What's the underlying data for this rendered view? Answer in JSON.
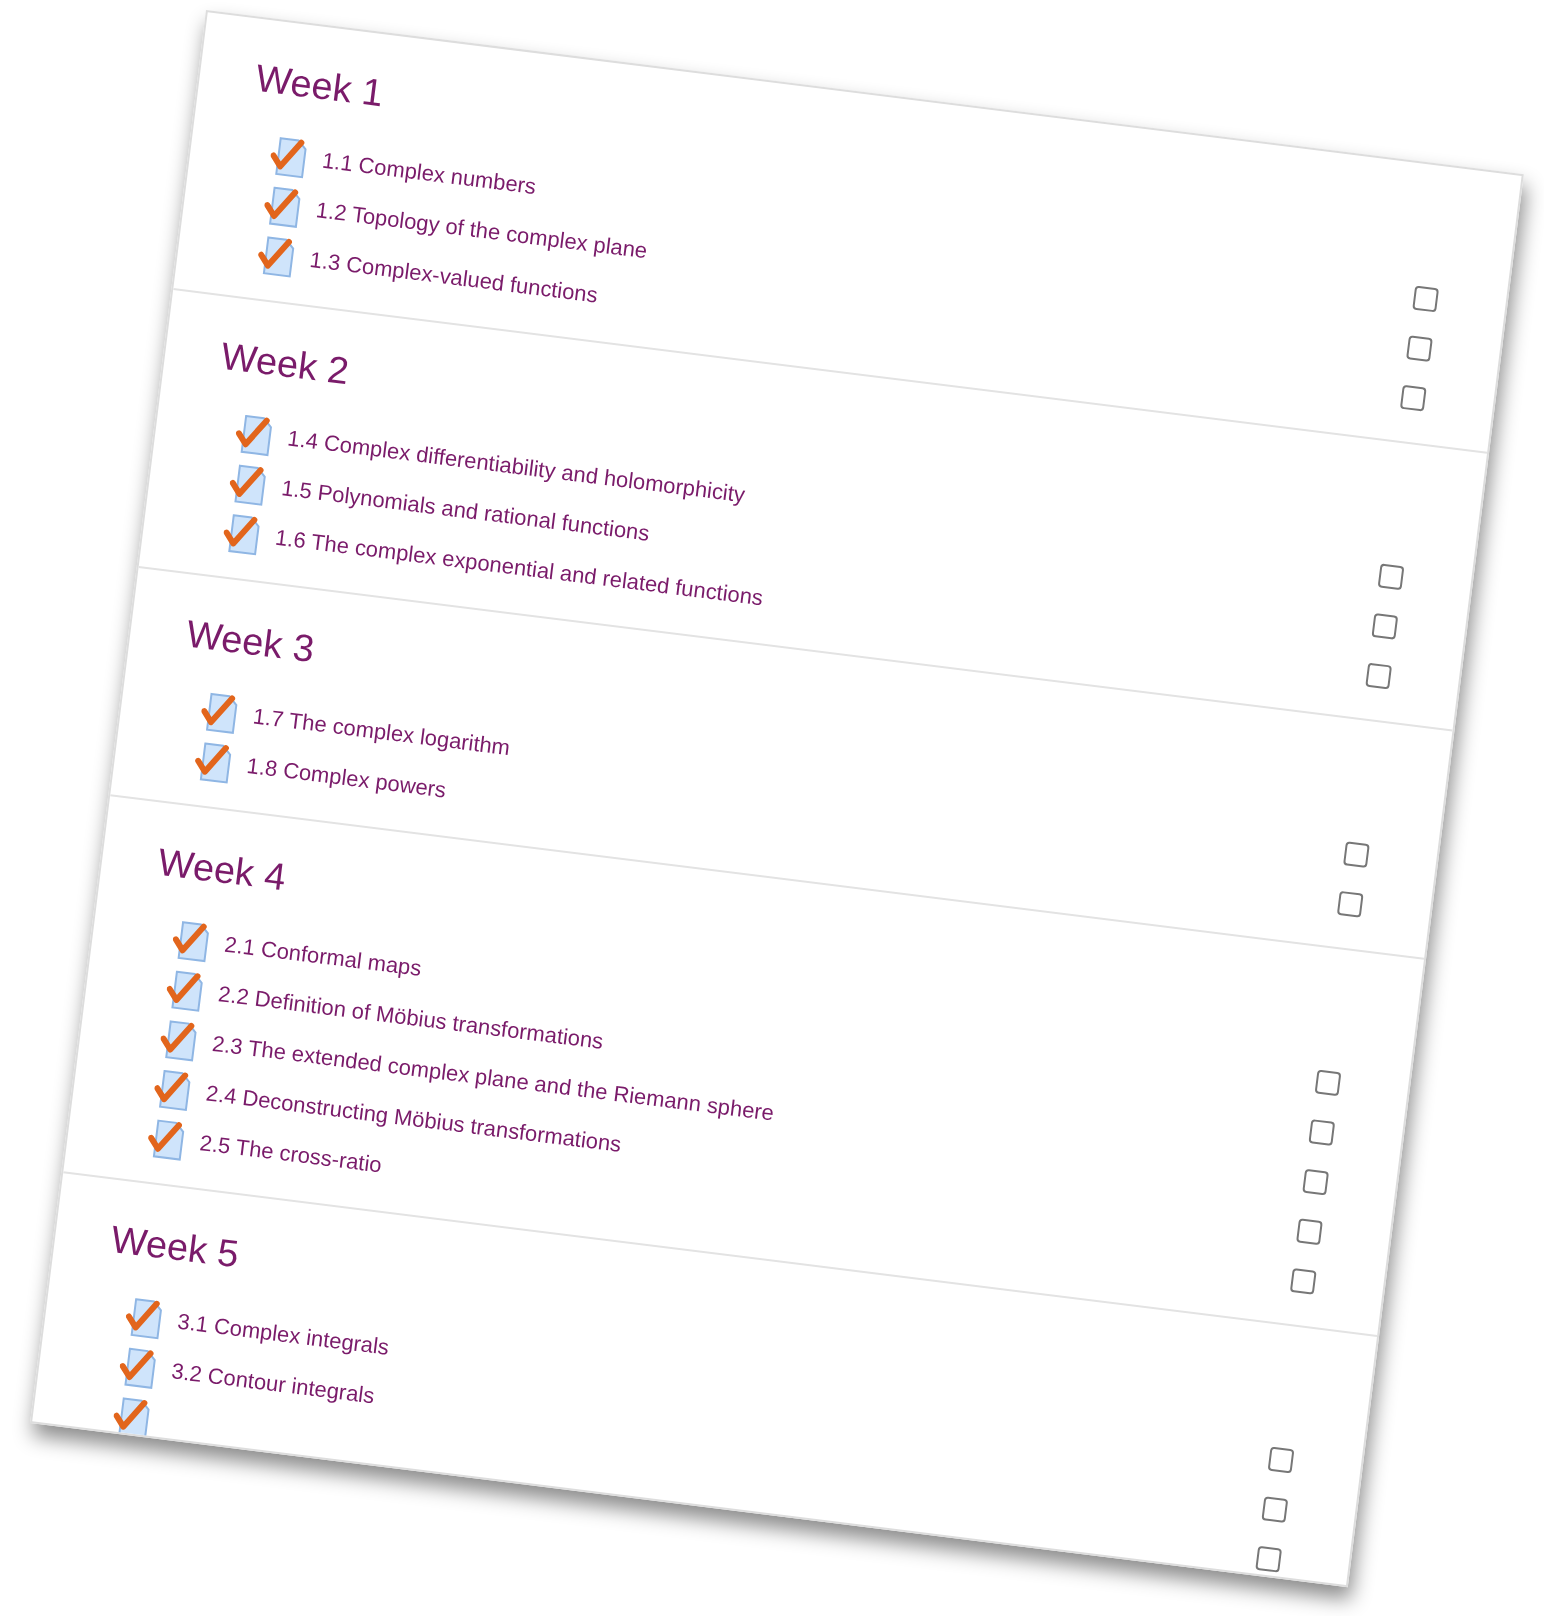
{
  "weeks": [
    {
      "title": "Week 1",
      "items": [
        {
          "kind": "link",
          "title": "1.1 Complex numbers"
        },
        {
          "kind": "link",
          "title": "1.2 Topology of the complex plane"
        },
        {
          "kind": "link",
          "title": "1.3 Complex-valued functions"
        }
      ],
      "checkboxes": [
        {
          "checked": false
        },
        {
          "checked": false
        },
        {
          "checked": false
        }
      ]
    },
    {
      "title": "Week 2",
      "items": [
        {
          "kind": "link",
          "title": "1.4 Complex differentiability and holomorphicity"
        },
        {
          "kind": "link",
          "title": "1.5 Polynomials and rational functions"
        },
        {
          "kind": "link",
          "title": "1.6 The complex exponential and related functions"
        }
      ],
      "checkboxes": [
        {
          "checked": false
        },
        {
          "checked": false
        },
        {
          "checked": false
        }
      ]
    },
    {
      "title": "Week 3",
      "items": [
        {
          "kind": "link",
          "title": "1.7 The complex logarithm"
        },
        {
          "kind": "link",
          "title": "1.8 Complex powers"
        }
      ],
      "checkboxes": [
        {
          "checked": false
        },
        {
          "checked": false
        }
      ]
    },
    {
      "title": "Week 4",
      "items": [
        {
          "kind": "link",
          "title": "2.1 Conformal maps"
        },
        {
          "kind": "link",
          "title": "2.2 Definition of Möbius transformations"
        },
        {
          "kind": "link",
          "title": "2.3 The extended complex plane and the Riemann sphere"
        },
        {
          "kind": "link",
          "title": "2.4 Deconstructing Möbius transformations"
        },
        {
          "kind": "link",
          "title": "2.5 The cross-ratio"
        }
      ],
      "checkboxes": [
        {
          "checked": false
        },
        {
          "checked": false
        },
        {
          "checked": false
        },
        {
          "checked": false
        },
        {
          "checked": false
        }
      ]
    },
    {
      "title": "Week 5",
      "items": [
        {
          "kind": "link",
          "title": "3.1 Complex integrals"
        },
        {
          "kind": "link",
          "title": "3.2 Contour integrals"
        },
        {
          "kind": "cut"
        }
      ],
      "checkboxes": [
        {
          "checked": false
        },
        {
          "checked": false
        },
        {
          "checked": false
        }
      ]
    }
  ]
}
